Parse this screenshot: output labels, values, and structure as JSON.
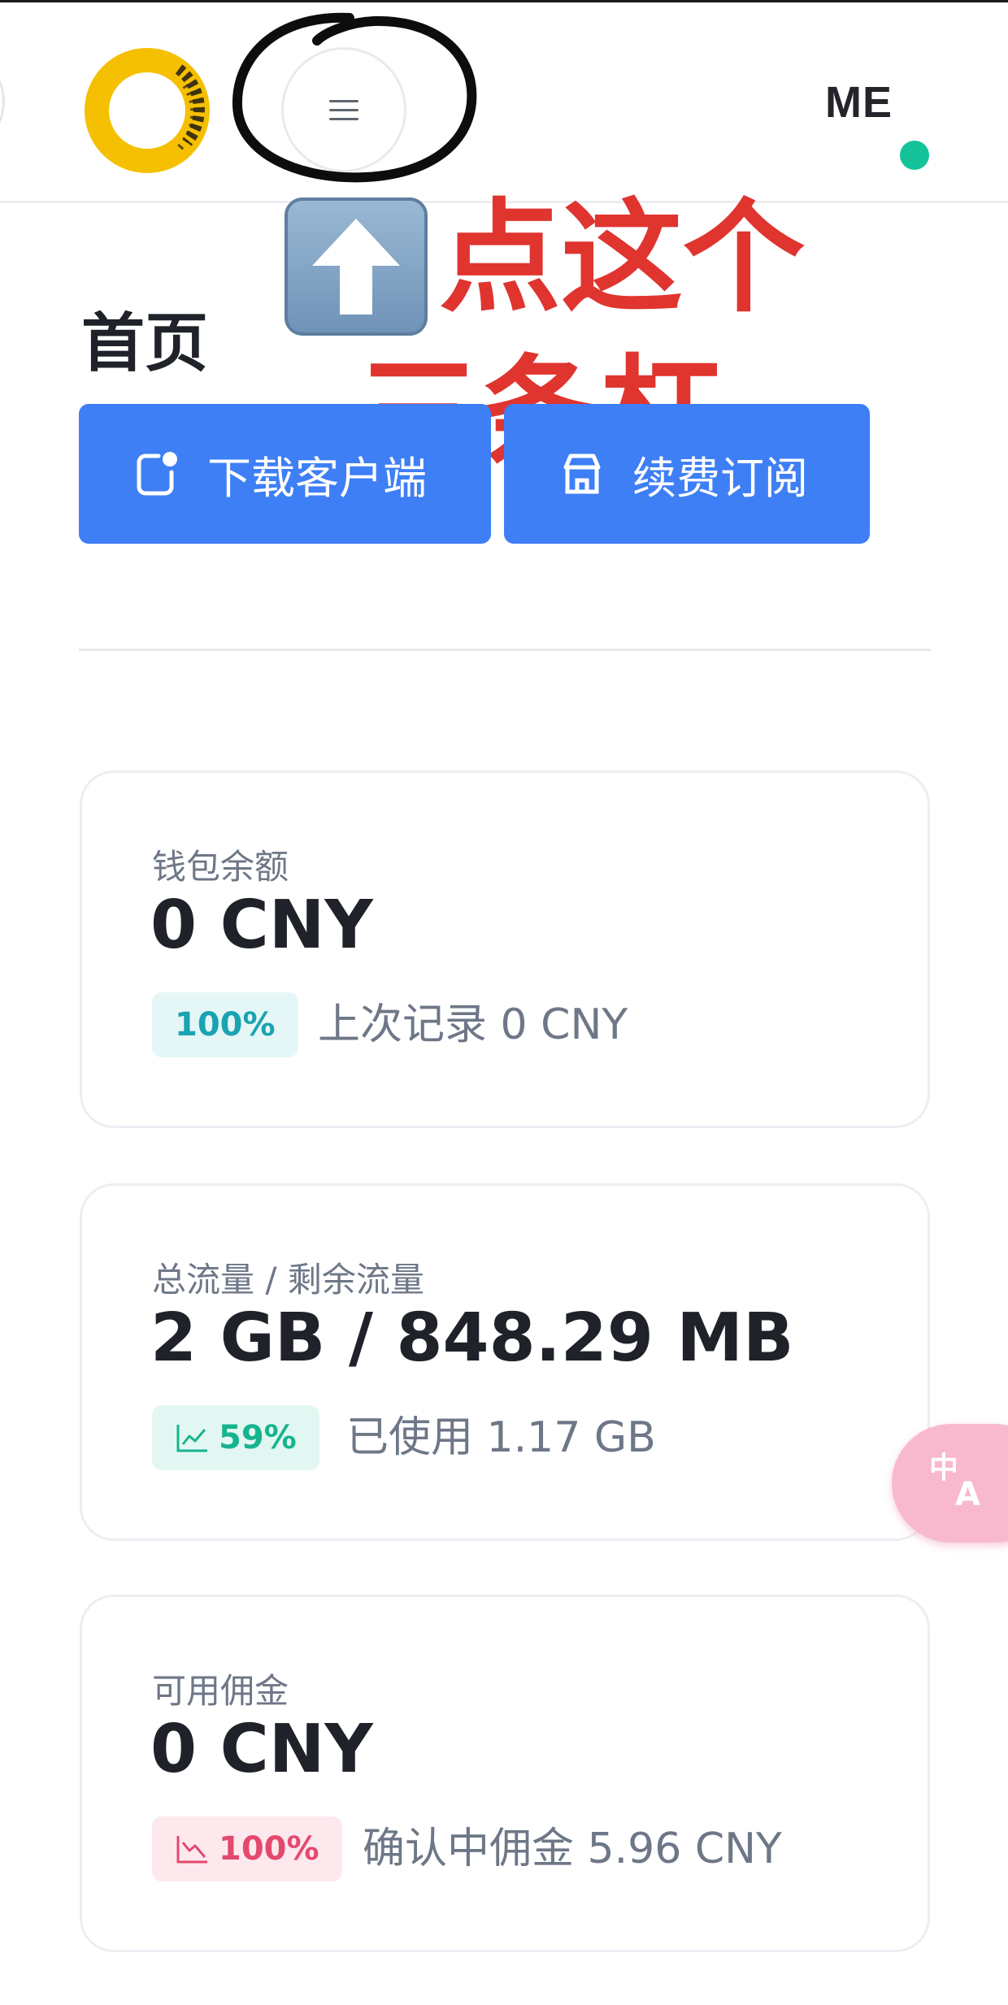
{
  "header": {
    "avatar_text": "ME",
    "status_color": "#14c39a",
    "menu_icon": "hamburger-menu-icon",
    "logo_icon": "ring-logo-icon"
  },
  "annotation": {
    "line1": "点这个",
    "line2": "三条杠",
    "arrow_icon": "up-arrow-emoji",
    "color": "#e0342f"
  },
  "page": {
    "title": "首页"
  },
  "actions": {
    "download_label": "下载客户端",
    "renew_label": "续费订阅",
    "accent": "#3e7ff5"
  },
  "cards": {
    "wallet": {
      "label": "钱包余额",
      "value": "0 CNY",
      "badge": "100%",
      "note": "上次记录 0 CNY"
    },
    "traffic": {
      "label": "总流量 / 剩余流量",
      "value": "2 GB / 848.29 MB",
      "badge": "59%",
      "note": "已使用 1.17 GB"
    },
    "commission": {
      "label": "可用佣金",
      "value": "0 CNY",
      "badge": "100%",
      "note": "确认中佣金 5.96 CNY"
    }
  },
  "floating": {
    "translate_icon": "translate-icon"
  }
}
